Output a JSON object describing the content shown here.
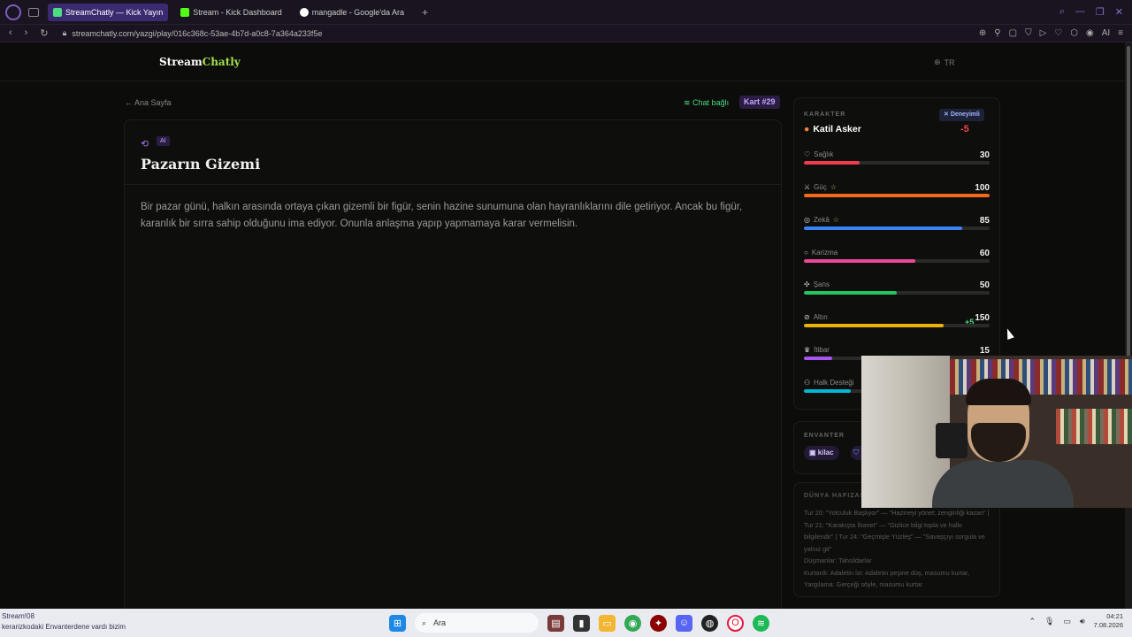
{
  "browser": {
    "tabs": [
      {
        "label": "StreamChatly — Kick Yayın",
        "active": true,
        "color": "#4ade80"
      },
      {
        "label": "Stream - Kick Dashboard",
        "active": false,
        "color": "#53fc18"
      },
      {
        "label": "mangadle - Google'da Ara",
        "active": false,
        "color": "#4285f4"
      }
    ],
    "url": "streamchatly.com/yazgi/play/016c368c-53ae-4b7d-a0c8-7a364a233f5e",
    "ai_label": "AI"
  },
  "header": {
    "logo_a": "Stream",
    "logo_b": "Chatly",
    "lang": "TR"
  },
  "nav": {
    "back": "← Ana Sayfa",
    "chat_status": "Chat bağlı",
    "card_badge": "Kart #29"
  },
  "story": {
    "badge": "AI",
    "title": "Pazarın Gizemi",
    "text": "Bir pazar günü, halkın arasında ortaya çıkan gizemli bir figür, senin hazine sunumuna olan hayranlıklarını dile getiriyor. Ancak bu figür, karanlık bir sırra sahip olduğunu ima ediyor. Onunla anlaşma yapıp yapmamaya karar vermelisin."
  },
  "character": {
    "section_label": "KARAKTER",
    "badge": "Deneyimli",
    "name": "Katil Asker",
    "delta": "-5",
    "stats": [
      {
        "label": "Sağlık",
        "value": "30",
        "fraction": 0.3,
        "color": "#ef3b4e",
        "icon": "heart-icon",
        "glyph": "♡",
        "star": false
      },
      {
        "label": "Güç",
        "value": "100",
        "fraction": 1.0,
        "color": "#f26a1b",
        "icon": "sword-icon",
        "glyph": "⚔",
        "star": true
      },
      {
        "label": "Zekâ",
        "value": "85",
        "fraction": 0.85,
        "color": "#3b82f6",
        "icon": "brain-icon",
        "glyph": "◎",
        "star": true
      },
      {
        "label": "Karizma",
        "value": "60",
        "fraction": 0.6,
        "color": "#ec4899",
        "icon": "chat-icon",
        "glyph": "○",
        "star": false
      },
      {
        "label": "Şans",
        "value": "50",
        "fraction": 0.5,
        "color": "#22c55e",
        "icon": "dice-icon",
        "glyph": "✣",
        "star": false
      },
      {
        "label": "Altın",
        "value": "150",
        "fraction": 0.75,
        "color": "#eab308",
        "icon": "coin-icon",
        "glyph": "⊘",
        "star": false,
        "bonus": "+5"
      },
      {
        "label": "İtibar",
        "value": "15",
        "fraction": 0.15,
        "color": "#a855f7",
        "icon": "crown-icon",
        "glyph": "♛",
        "star": false
      },
      {
        "label": "Halk Desteği",
        "value": "",
        "fraction": 0.25,
        "color": "#06b6d4",
        "icon": "people-icon",
        "glyph": "⚇",
        "star": false
      }
    ]
  },
  "inventory": {
    "label": "ENVANTER",
    "items": [
      "kilac"
    ]
  },
  "memory": {
    "label": "DÜNYA HAFIZASI",
    "text": "Tur 20: \"Yolculuk Başlıyor\" — \"Hazineyi yönet; zenginliği kazan\" | Tur 21: \"Karakışta İhanet\" — \"Gizlice bilgi topla ve halkı bilgilendir\" | Tur 24: \"Geçmişle Yüzleş\" — \"Savaşçıyı sorgula ve yalnız git\"",
    "line2": "Düşmanlar: Tahsildarlar",
    "line3": "Kurtardı: Adaletin İzi: Adaletin peşine düş, masumu kurtar, Yargılama: Gerçeği söyle, masumu kurtar"
  },
  "taskbar": {
    "notice_top": "Stream!08",
    "notice_bottom": "kerarizkodaki Envanterdene vardı bizim",
    "search": "Ara",
    "time": "04:21",
    "date": "7.08.2026"
  }
}
